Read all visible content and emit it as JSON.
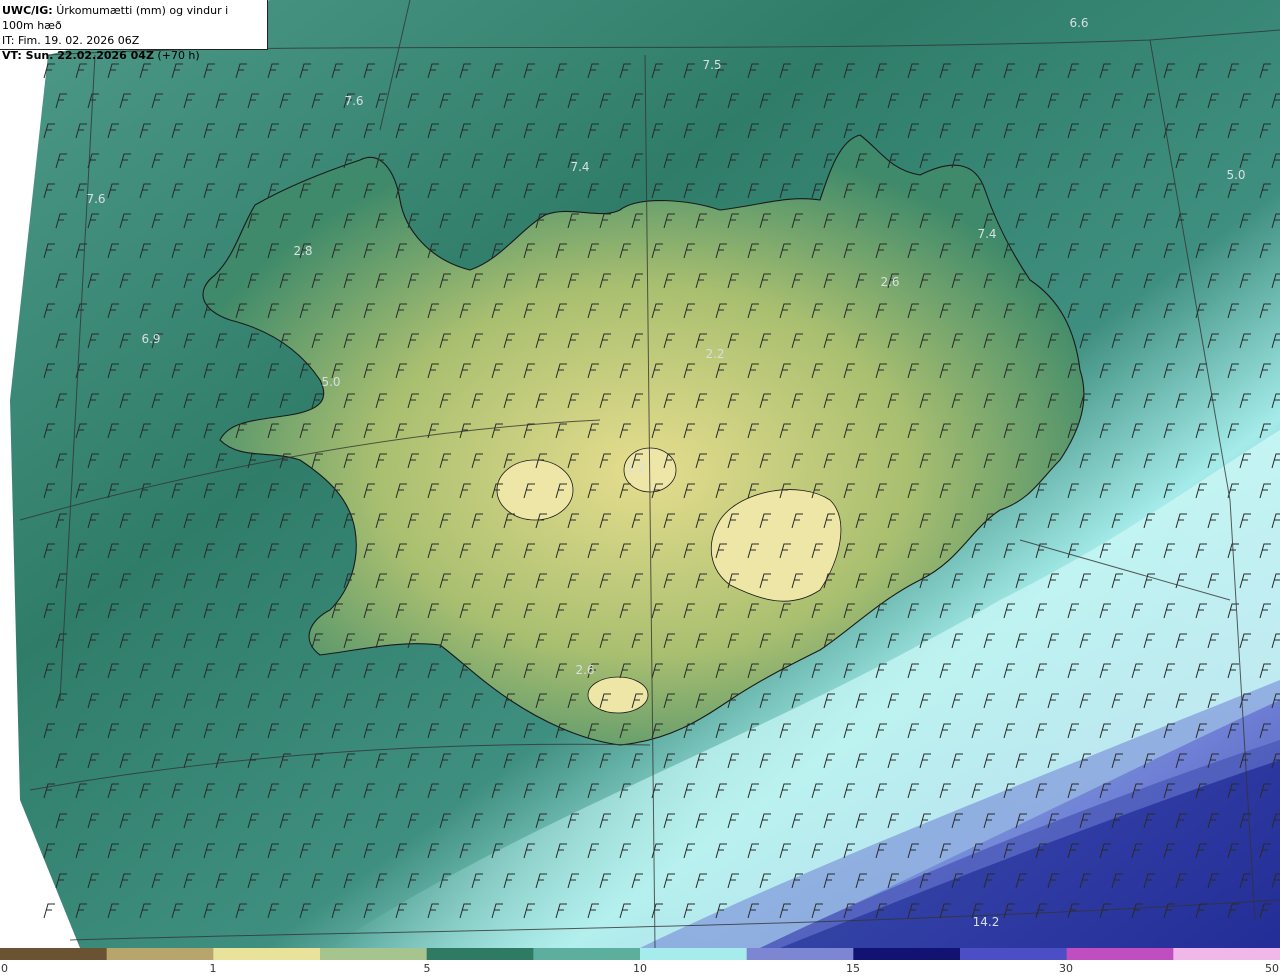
{
  "header": {
    "model_prefix": "UWC/IG:",
    "title": "Úrkomumætti (mm) og vindur i 100m hæð",
    "init_line": "IT: Fim. 19. 02. 2026 06Z",
    "valid_prefix": "VT: Sun. 22.02.2026 04Z",
    "valid_suffix": " (+70 h)"
  },
  "map_labels": [
    "6.6",
    "7.5",
    "7.6",
    "7.4",
    "5.0",
    "7.6",
    "2.8",
    "7.4",
    "2.6",
    "6.9",
    "2.2",
    "5.0",
    "1.2",
    "2.6",
    "14.2"
  ],
  "colorbar": {
    "ticks": [
      "0",
      "1",
      "5",
      "10",
      "15",
      "30",
      "50"
    ],
    "colors": [
      "#6b5233",
      "#b8a56b",
      "#e9e29a",
      "#a6c48e",
      "#2f7a63",
      "#5cae9d",
      "#a6ecec",
      "#7d86d2",
      "#121272",
      "#4b4ec4",
      "#c04ec0",
      "#f0b8e8"
    ]
  },
  "colors": {
    "land_high": "#e6dd8e",
    "land_mid": "#9fb96a",
    "sea": "#2f7d69",
    "wet": "#a4ebe9",
    "heavy": "#1c1f86"
  }
}
